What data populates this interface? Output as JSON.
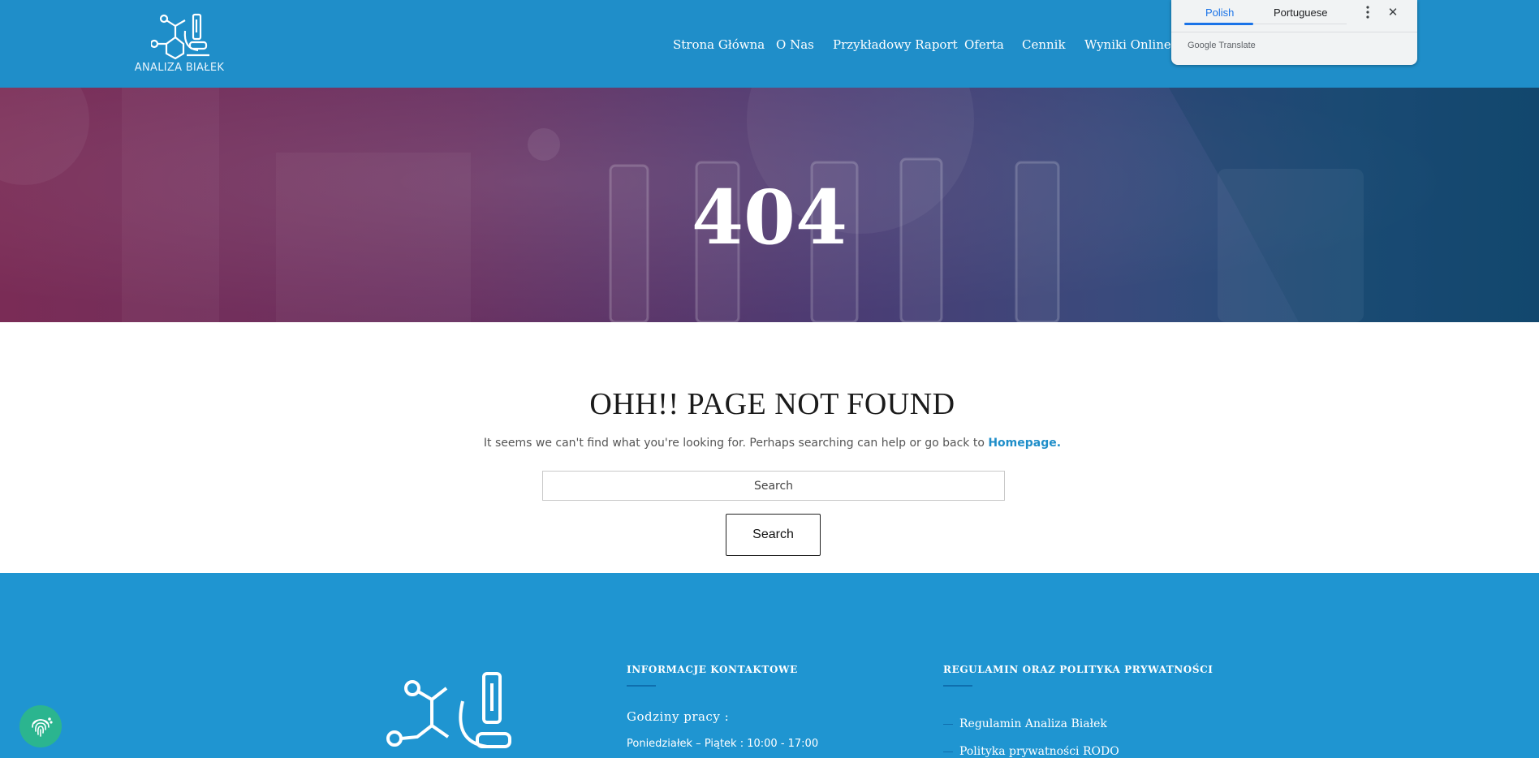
{
  "brand": {
    "name": "ANALIZA BIAŁEK"
  },
  "nav": {
    "items": [
      {
        "label": "Strona Główna"
      },
      {
        "label": "O Nas"
      },
      {
        "label": "Przykładowy Raport"
      },
      {
        "label": "Oferta"
      },
      {
        "label": "Cennik"
      },
      {
        "label": "Wyniki Online"
      }
    ]
  },
  "translate": {
    "languages": [
      "Polish",
      "Portuguese"
    ],
    "active_language": "Polish",
    "brand_google": "Google",
    "brand_translate": "Translate",
    "more_icon": "more-vertical-icon",
    "close_icon": "close-icon",
    "accent_color": "#1a73e8"
  },
  "hero": {
    "title": "404"
  },
  "not_found": {
    "title": "OHH!! PAGE NOT FOUND",
    "text": "It seems we can't find what you're looking for. Perhaps searching can help or go back to",
    "homepage_link": "Homepage.",
    "search_placeholder": "Search",
    "search_button": "Search"
  },
  "footer": {
    "contact": {
      "heading": "INFORMACJE KONTAKTOWE",
      "hours_label": "Godziny pracy :",
      "hours": "Poniedziałek – Piątek : 10:00 - 17:00"
    },
    "policy": {
      "heading": "REGULAMIN ORAZ POLITYKA PRYWATNOŚCI",
      "links": [
        "Regulamin Analiza Białek",
        "Polityka prywatności RODO"
      ]
    }
  },
  "colors": {
    "header_bg": "#1f8ec9",
    "footer_bg": "#1f95d1",
    "link": "#1f8ec9",
    "accessibility_button": "#2bb58f"
  }
}
